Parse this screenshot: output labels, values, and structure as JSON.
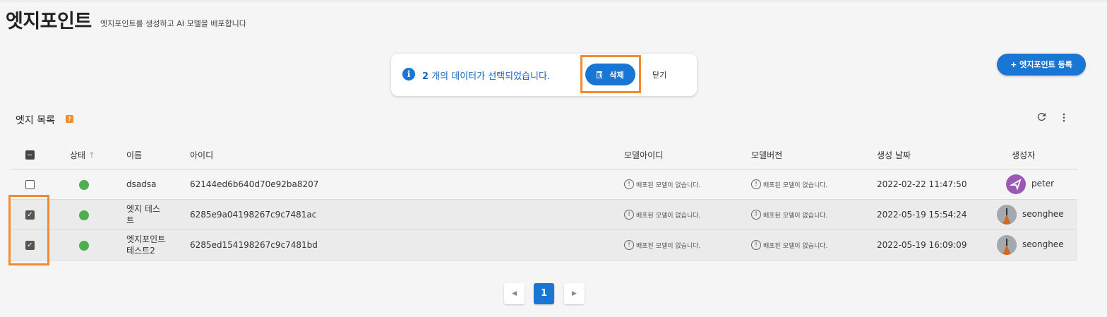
{
  "header": {
    "title": "엣지포인트",
    "subtitle": "엣지포인트를 생성하고 AI 모델을 배포합니다"
  },
  "selection_bar": {
    "count": "2",
    "message": "개의 데이터가 선택되었습니다.",
    "delete_label": "삭제",
    "close_label": "닫기",
    "info_icon": "i"
  },
  "toolbar": {
    "add_label": "+ 엣지포인트 등록"
  },
  "list": {
    "title": "엣지 목록",
    "help_icon": "?"
  },
  "table": {
    "columns": {
      "status": "상태",
      "sort_indicator": "↑",
      "name": "이름",
      "id": "아이디",
      "model_id": "모델아이디",
      "model_version": "모델버전",
      "created_date": "생성 날짜",
      "creator": "생성자"
    },
    "rows": [
      {
        "checked": false,
        "name_line1": "dsadsa",
        "name_line2": "",
        "id": "62144ed6b640d70e92ba8207",
        "model_id": "배포된 모델이 없습니다.",
        "model_version": "배포된 모델이 없습니다.",
        "created": "2022-02-22 11:47:50",
        "creator": "peter"
      },
      {
        "checked": true,
        "name_line1": "엣지 테스",
        "name_line2": "트",
        "id": "6285e9a04198267c9c7481ac",
        "model_id": "배포된 모델이 없습니다.",
        "model_version": "배포된 모델이 없습니다.",
        "created": "2022-05-19 15:54:24",
        "creator": "seonghee"
      },
      {
        "checked": true,
        "name_line1": "엣지포인트",
        "name_line2": "테스트2",
        "id": "6285ed154198267c9c7481bd",
        "model_id": "배포된 모델이 없습니다.",
        "model_version": "배포된 모델이 없습니다.",
        "created": "2022-05-19 16:09:09",
        "creator": "seonghee"
      }
    ],
    "warn_glyph": "!",
    "check_glyph": "✓"
  },
  "pagination": {
    "prev": "◀",
    "current": "1",
    "next": "▶"
  },
  "colors": {
    "primary": "#1976d2",
    "status_active": "#4caf50",
    "highlight": "#f28a2e"
  }
}
